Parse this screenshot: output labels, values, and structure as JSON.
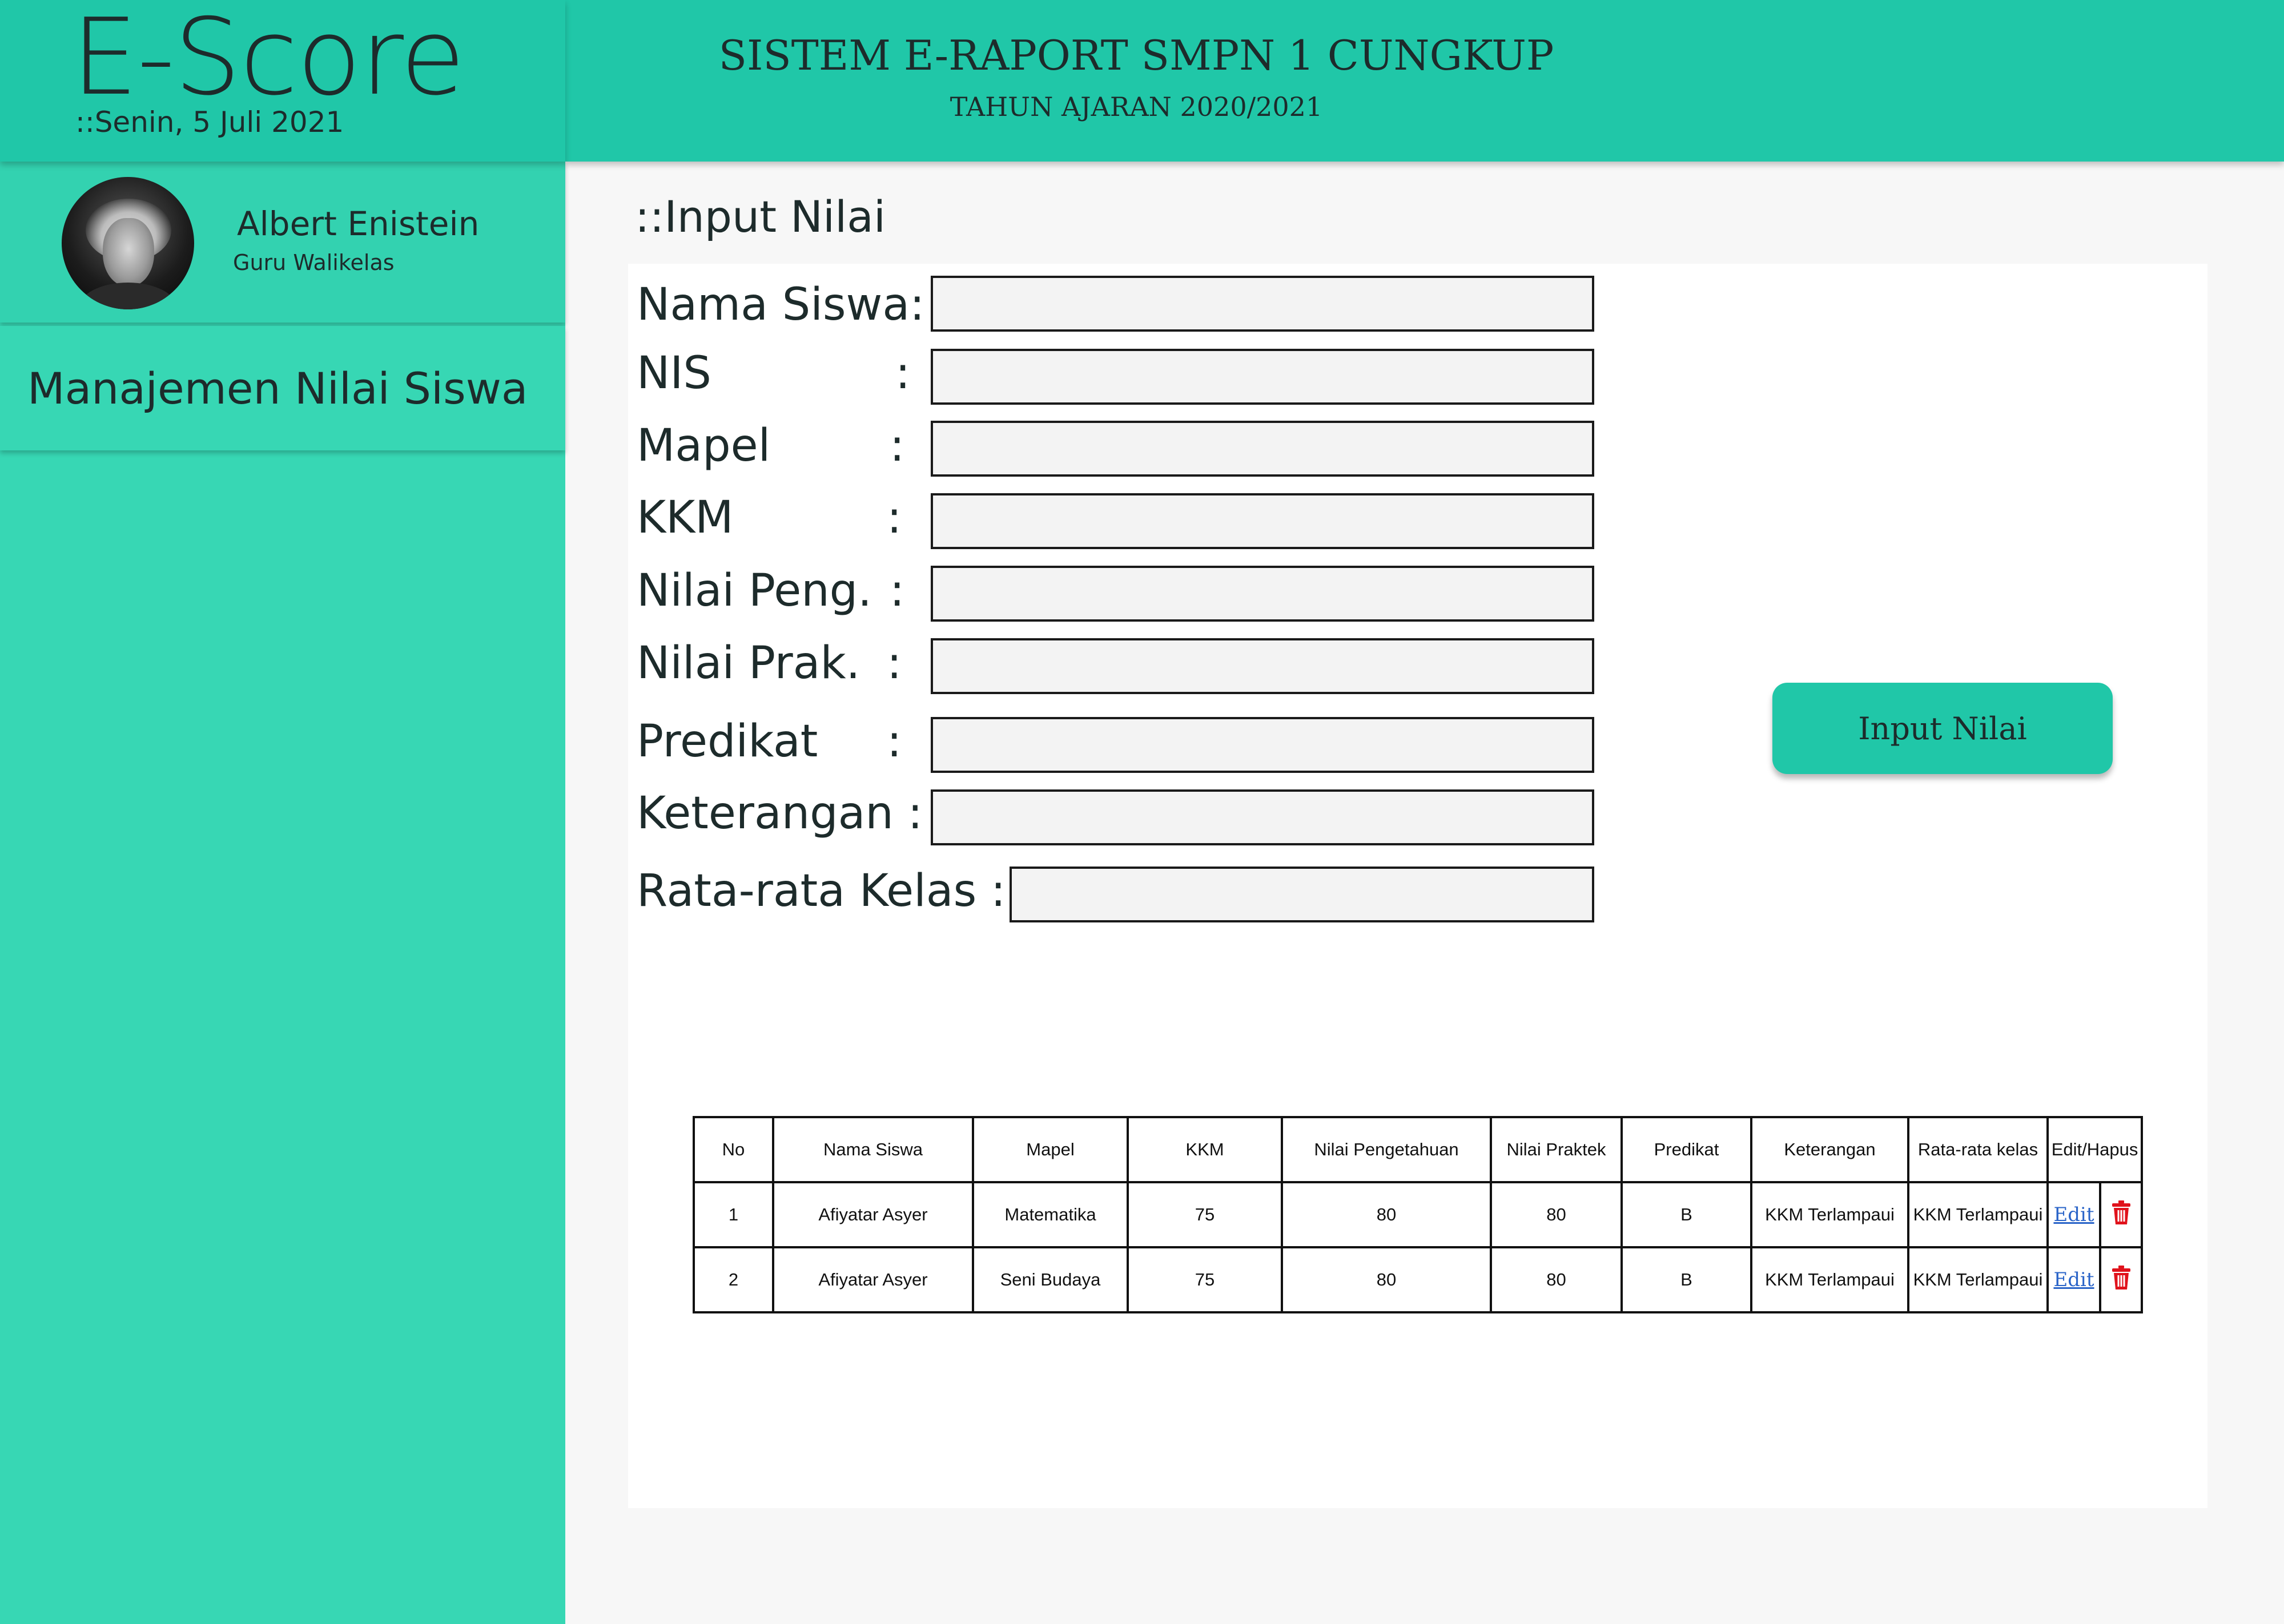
{
  "brand": {
    "title": "E-Score",
    "date": "::Senin, 5 Juli 2021"
  },
  "header": {
    "title": "SISTEM E-RAPORT SMPN 1 CUNGKUP",
    "subtitle": "TAHUN AJARAN 2020/2021"
  },
  "user": {
    "name": "Albert Enistein",
    "role": "Guru Walikelas"
  },
  "sidebar": {
    "items": [
      {
        "label": "Manajemen Nilai Siswa"
      }
    ]
  },
  "page": {
    "heading": "::Input Nilai"
  },
  "form": {
    "fields": [
      {
        "label": "Nama Siswa:",
        "colon": "",
        "value": ""
      },
      {
        "label": "NIS",
        "colon": ":",
        "value": ""
      },
      {
        "label": "Mapel",
        "colon": ":",
        "value": ""
      },
      {
        "label": "KKM",
        "colon": ":",
        "value": ""
      },
      {
        "label": "Nilai Peng.",
        "colon": ":",
        "value": ""
      },
      {
        "label": "Nilai Prak.",
        "colon": ":",
        "value": ""
      },
      {
        "label": "Predikat",
        "colon": ":",
        "value": ""
      },
      {
        "label": "Keterangan :",
        "colon": "",
        "value": ""
      },
      {
        "label": "Rata-rata Kelas :",
        "colon": "",
        "value": ""
      }
    ],
    "submit_label": "Input Nilai"
  },
  "table": {
    "headers": [
      "No",
      "Nama Siswa",
      "Mapel",
      "KKM",
      "Nilai Pengetahuan",
      "Nilai Praktek",
      "Predikat",
      "Keterangan",
      "Rata-rata kelas",
      "Edit/Hapus"
    ],
    "rows": [
      [
        "1",
        "Afiyatar Asyer",
        "Matematika",
        "75",
        "80",
        "80",
        "B",
        "KKM Terlampaui",
        "KKM Terlampaui"
      ],
      [
        "2",
        "Afiyatar Asyer",
        "Seni Budaya",
        "75",
        "80",
        "80",
        "B",
        "KKM Terlampaui",
        "KKM Terlampaui"
      ]
    ],
    "edit_label": "Edit",
    "delete_icon": "trash-icon"
  },
  "colors": {
    "accent": "#20c7a8",
    "sidebar": "#37d7b4",
    "delete": "#e0121b",
    "link": "#2a64c8"
  }
}
